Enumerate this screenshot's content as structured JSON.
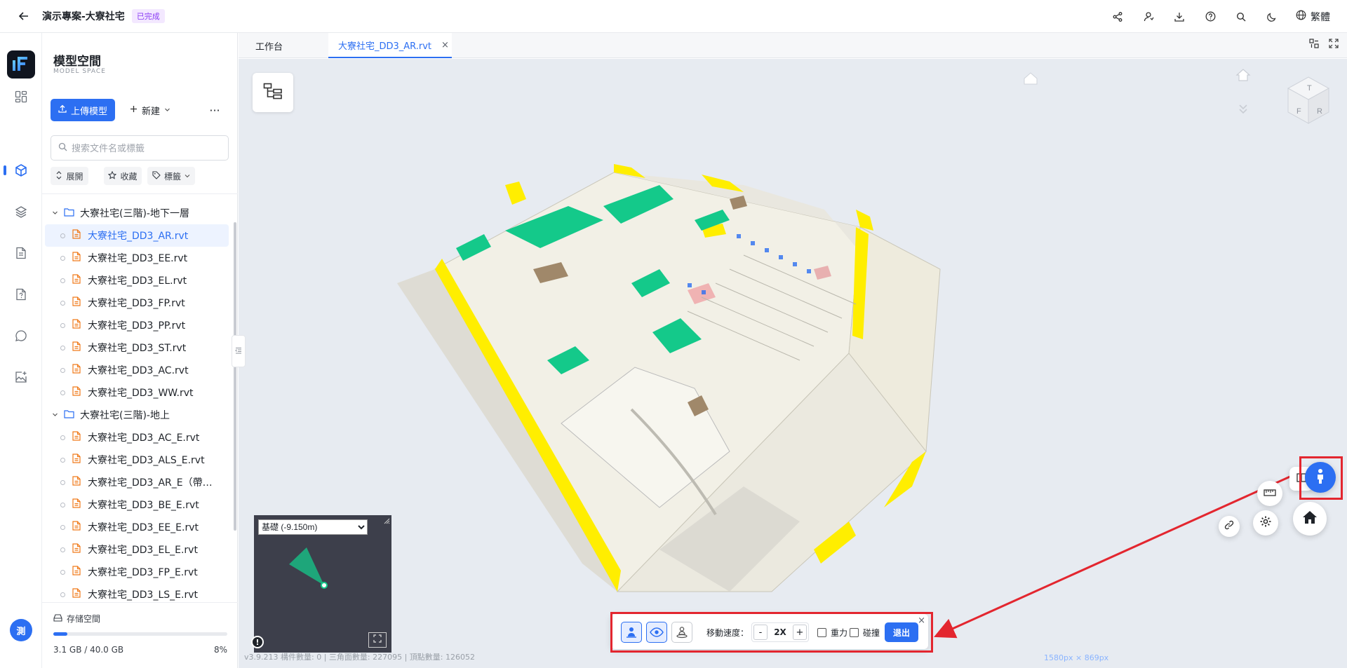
{
  "header": {
    "project_title": "演示專案-大寮社宅",
    "status_badge": "已完成",
    "language": "繁體",
    "icons": [
      "share-icon",
      "user-switch-icon",
      "download-icon",
      "help-icon",
      "search-icon",
      "dark-mode-icon",
      "globe-icon"
    ]
  },
  "rail": {
    "items": [
      "dashboard-icon",
      "model-cube-icon",
      "layers-icon",
      "document-icon",
      "file-question-icon",
      "chat-icon",
      "image-add-icon"
    ],
    "active_index": 1,
    "avatar_text": "測"
  },
  "panel": {
    "title": "模型空間",
    "subtitle": "MODEL SPACE",
    "upload_label": "上傳模型",
    "new_label": "新建",
    "more_label": "···",
    "search_placeholder": "搜索文件名或標籤",
    "filters": {
      "expand": "展開",
      "favorite": "收藏",
      "tags": "標籤"
    },
    "tree": [
      {
        "type": "folder",
        "label": "大寮社宅(三階)-地下一層"
      },
      {
        "type": "file",
        "label": "大寮社宅_DD3_AR.rvt",
        "selected": true
      },
      {
        "type": "file",
        "label": "大寮社宅_DD3_EE.rvt"
      },
      {
        "type": "file",
        "label": "大寮社宅_DD3_EL.rvt"
      },
      {
        "type": "file",
        "label": "大寮社宅_DD3_FP.rvt"
      },
      {
        "type": "file",
        "label": "大寮社宅_DD3_PP.rvt"
      },
      {
        "type": "file",
        "label": "大寮社宅_DD3_ST.rvt"
      },
      {
        "type": "file",
        "label": "大寮社宅_DD3_AC.rvt"
      },
      {
        "type": "file",
        "label": "大寮社宅_DD3_WW.rvt"
      },
      {
        "type": "folder",
        "label": "大寮社宅(三階)-地上"
      },
      {
        "type": "file",
        "label": "大寮社宅_DD3_AC_E.rvt"
      },
      {
        "type": "file",
        "label": "大寮社宅_DD3_ALS_E.rvt"
      },
      {
        "type": "file",
        "label": "大寮社宅_DD3_AR_E（帶房..."
      },
      {
        "type": "file",
        "label": "大寮社宅_DD3_BE_E.rvt"
      },
      {
        "type": "file",
        "label": "大寮社宅_DD3_EE_E.rvt"
      },
      {
        "type": "file",
        "label": "大寮社宅_DD3_EL_E.rvt"
      },
      {
        "type": "file",
        "label": "大寮社宅_DD3_FP_E.rvt"
      },
      {
        "type": "file",
        "label": "大寮社宅_DD3_LS_E.rvt"
      }
    ],
    "storage": {
      "label": "存储空間",
      "used_text": "3.1 GB / 40.0 GB",
      "percent_text": "8%",
      "fraction": 0.08
    }
  },
  "tabs": {
    "items": [
      {
        "label": "工作台"
      },
      {
        "label": "大寮社宅_DD3_AR.rvt",
        "active": true
      }
    ],
    "close_glyph": "×"
  },
  "viewer": {
    "minimap": {
      "level_options": [
        "基礎 (-9.150m)"
      ],
      "selected_level": "基礎 (-9.150m)",
      "info_glyph": "!"
    },
    "status_line": "v3.9.213  構件數量: 0 | 三角面數量: 227095 | 頂點數量: 126052",
    "navcube_faces": {
      "top": "T",
      "front": "F",
      "right": "R"
    },
    "watermark": "1580px × 869px",
    "walk_toolbar": {
      "speed_label": "移動速度：",
      "speed_minus": "-",
      "speed_value": "2X",
      "speed_plus": "+",
      "gravity_label": "重力",
      "collision_label": "碰撞",
      "exit_label": "退出",
      "close_glyph": "×"
    }
  },
  "colors": {
    "accent": "#2c6ff2",
    "highlight": "#e3262f",
    "model_yellow": "#ffee00",
    "model_green": "#14c98a"
  }
}
